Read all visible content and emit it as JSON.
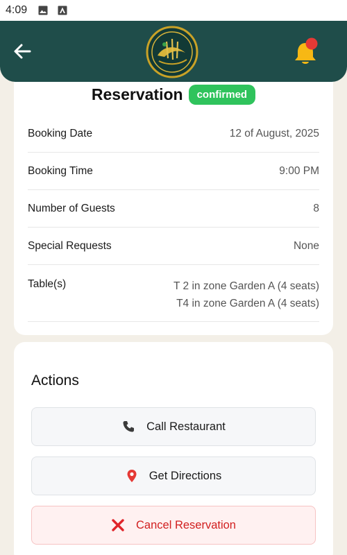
{
  "status_bar": {
    "time": "4:09"
  },
  "header": {
    "back_icon": "arrow-left-icon",
    "logo_icon": "restaurant-logo",
    "notification_icon": "bell-icon",
    "notification_dot_color": "#e53935"
  },
  "reservation": {
    "title": "Reservation",
    "status": "confirmed",
    "status_color": "#2fc35c",
    "details": [
      {
        "label": "Booking Date",
        "value": "12 of August, 2025"
      },
      {
        "label": "Booking Time",
        "value": "9:00 PM"
      },
      {
        "label": "Number of Guests",
        "value": "8"
      },
      {
        "label": "Special Requests",
        "value": "None"
      }
    ],
    "tables_label": "Table(s)",
    "tables": [
      "T 2 in zone Garden A (4 seats)",
      "T4 in zone Garden A (4 seats)"
    ]
  },
  "actions": {
    "title": "Actions",
    "call": {
      "label": "Call Restaurant",
      "icon": "phone-icon"
    },
    "directions": {
      "label": "Get Directions",
      "icon": "pin-icon"
    },
    "cancel": {
      "label": "Cancel Reservation",
      "icon": "close-x-icon"
    }
  },
  "colors": {
    "header_bg": "#1f4d4a",
    "page_bg": "#f3efe7",
    "cancel_text": "#d11f1f"
  }
}
